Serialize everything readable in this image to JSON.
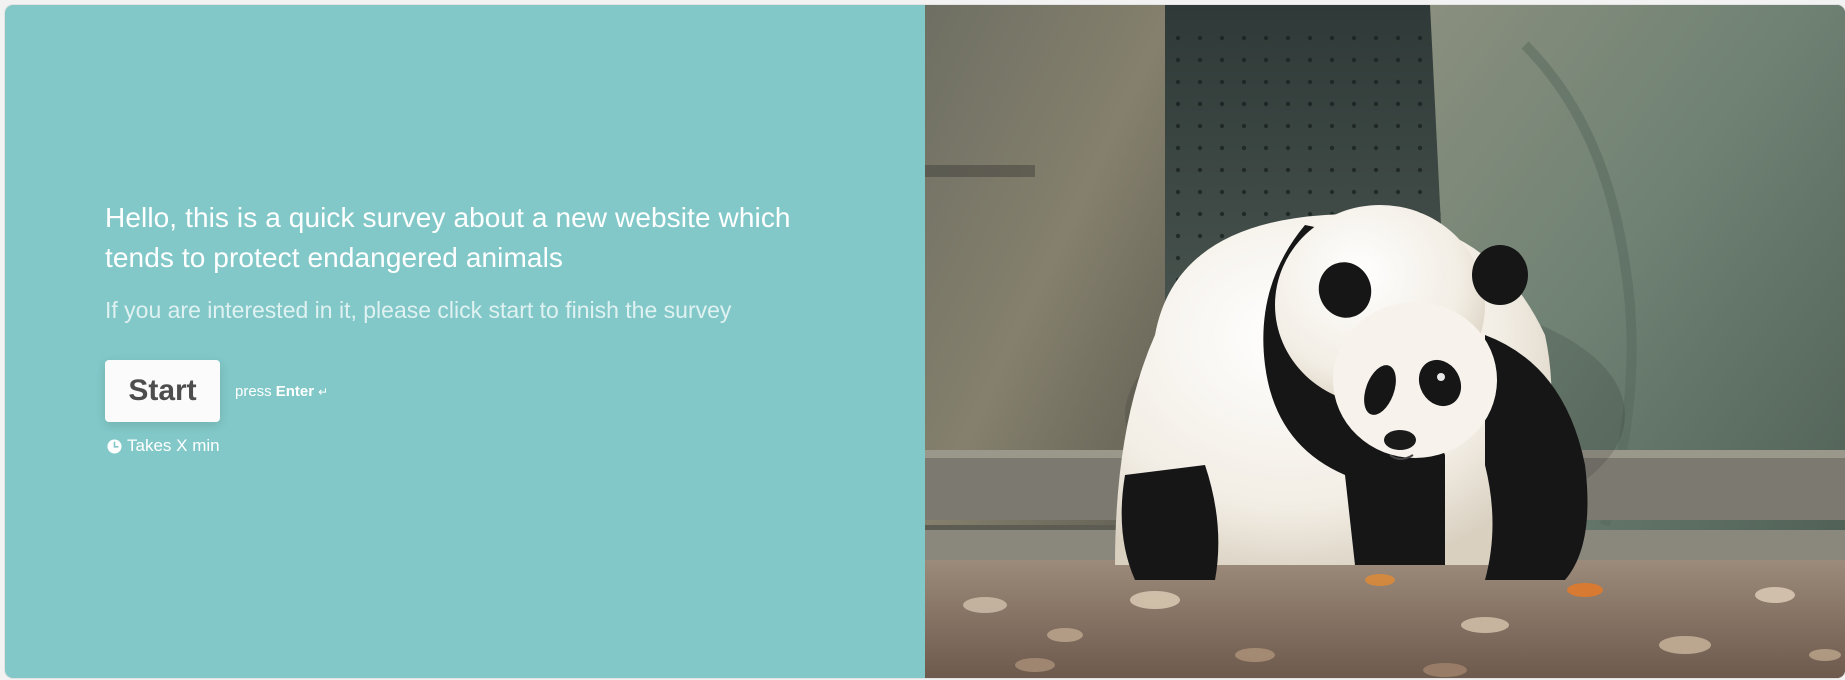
{
  "welcome": {
    "title": "Hello, this is a quick survey about a new website which tends to protect endangered animals",
    "subtitle": "If you are interested in it, please click start to finish the survey",
    "start_label": "Start",
    "press_label": "press",
    "key_label": "Enter",
    "enter_glyph": "↵",
    "duration_label": "Takes X min"
  },
  "image": {
    "subject": "giant panda walking on leaves",
    "description_icon": "panda-photo"
  },
  "colors": {
    "panel_bg": "#82c8c8",
    "button_bg": "#fbfbfb",
    "button_text": "#4d4d4d",
    "text": "#ffffff"
  }
}
